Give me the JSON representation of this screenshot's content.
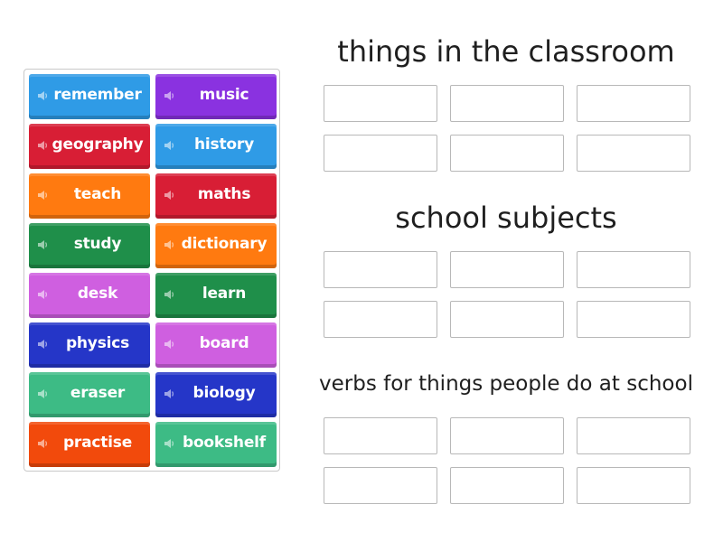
{
  "tiles": [
    {
      "label": "remember",
      "color": "#2f9be6"
    },
    {
      "label": "music",
      "color": "#8a32e0"
    },
    {
      "label": "geography",
      "color": "#d81e35"
    },
    {
      "label": "history",
      "color": "#2f9be6"
    },
    {
      "label": "teach",
      "color": "#ff7a10"
    },
    {
      "label": "maths",
      "color": "#d81e35"
    },
    {
      "label": "study",
      "color": "#1f8f4a"
    },
    {
      "label": "dictionary",
      "color": "#ff7a10"
    },
    {
      "label": "desk",
      "color": "#cf5fe0"
    },
    {
      "label": "learn",
      "color": "#1f8f4a"
    },
    {
      "label": "physics",
      "color": "#2536c8"
    },
    {
      "label": "board",
      "color": "#cf5fe0"
    },
    {
      "label": "eraser",
      "color": "#3dbb85"
    },
    {
      "label": "biology",
      "color": "#2536c8"
    },
    {
      "label": "practise",
      "color": "#f24a0c"
    },
    {
      "label": "bookshelf",
      "color": "#3dbb85"
    }
  ],
  "groups": [
    {
      "title": "things in the classroom",
      "slots": 6
    },
    {
      "title": "school subjects",
      "slots": 6
    },
    {
      "title": "verbs for things people do at school",
      "slots": 6
    }
  ],
  "icons": {
    "tile_icon": "speaker-icon"
  }
}
